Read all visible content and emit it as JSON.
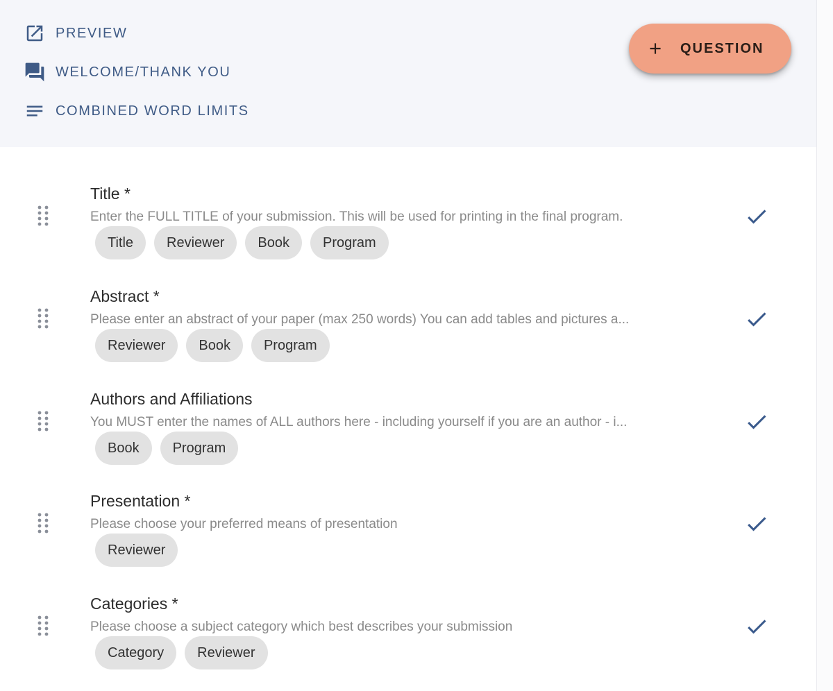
{
  "toolbar": {
    "preview_label": "PREVIEW",
    "welcome_label": "WELCOME/THANK YOU",
    "word_limits_label": "COMBINED WORD LIMITS",
    "add_question_label": "QUESTION"
  },
  "colors": {
    "accent": "#f1a184",
    "link": "#3f5b86",
    "check": "#3a5a8c",
    "chip_bg": "#e2e2e2"
  },
  "questions": [
    {
      "title": "Title *",
      "description": "Enter the FULL TITLE of your submission. This will be used for printing in the final program.",
      "tags": [
        "Title",
        "Reviewer",
        "Book",
        "Program"
      ]
    },
    {
      "title": "Abstract *",
      "description": "Please enter an abstract of your paper (max 250 words) You can add tables and pictures a...",
      "tags": [
        "Reviewer",
        "Book",
        "Program"
      ]
    },
    {
      "title": "Authors and Affiliations",
      "description": "You MUST enter the names of ALL authors here - including yourself if you are an author - i...",
      "tags": [
        "Book",
        "Program"
      ]
    },
    {
      "title": "Presentation *",
      "description": "Please choose your preferred means of presentation",
      "tags": [
        "Reviewer"
      ]
    },
    {
      "title": "Categories *",
      "description": "Please choose a subject category which best describes your submission",
      "tags": [
        "Category",
        "Reviewer"
      ]
    }
  ]
}
